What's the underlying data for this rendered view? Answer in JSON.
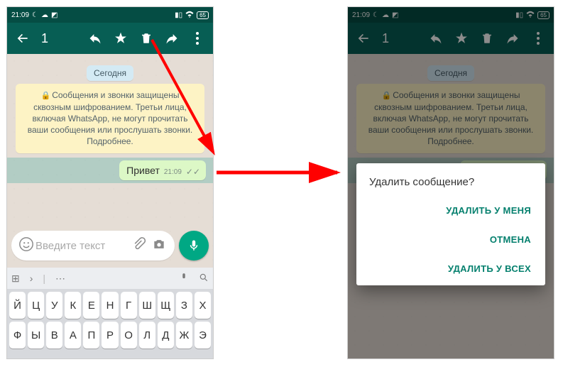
{
  "statusbar": {
    "time": "21:09",
    "battery": "65"
  },
  "toolbar": {
    "count": "1"
  },
  "chat": {
    "date_label": "Сегодня",
    "encryption_text": "Сообщения и звонки защищены сквозным шифрованием. Третьи лица, включая WhatsApp, не могут прочитать ваши сообщения или прослушать звонки. Подробнее.",
    "msg_text": "Привет",
    "msg_time": "21:09"
  },
  "input": {
    "placeholder": "Введите текст"
  },
  "keyboard": {
    "row1": [
      "Й",
      "Ц",
      "У",
      "К",
      "Е",
      "Н",
      "Г",
      "Ш",
      "Щ",
      "З",
      "Х"
    ],
    "row2": [
      "Ф",
      "Ы",
      "В",
      "А",
      "П",
      "Р",
      "О",
      "Л",
      "Д",
      "Ж",
      "Э"
    ]
  },
  "dialog": {
    "title": "Удалить сообщение?",
    "delete_me": "УДАЛИТЬ У МЕНЯ",
    "cancel": "ОТМЕНА",
    "delete_all": "УДАЛИТЬ У ВСЕХ"
  }
}
